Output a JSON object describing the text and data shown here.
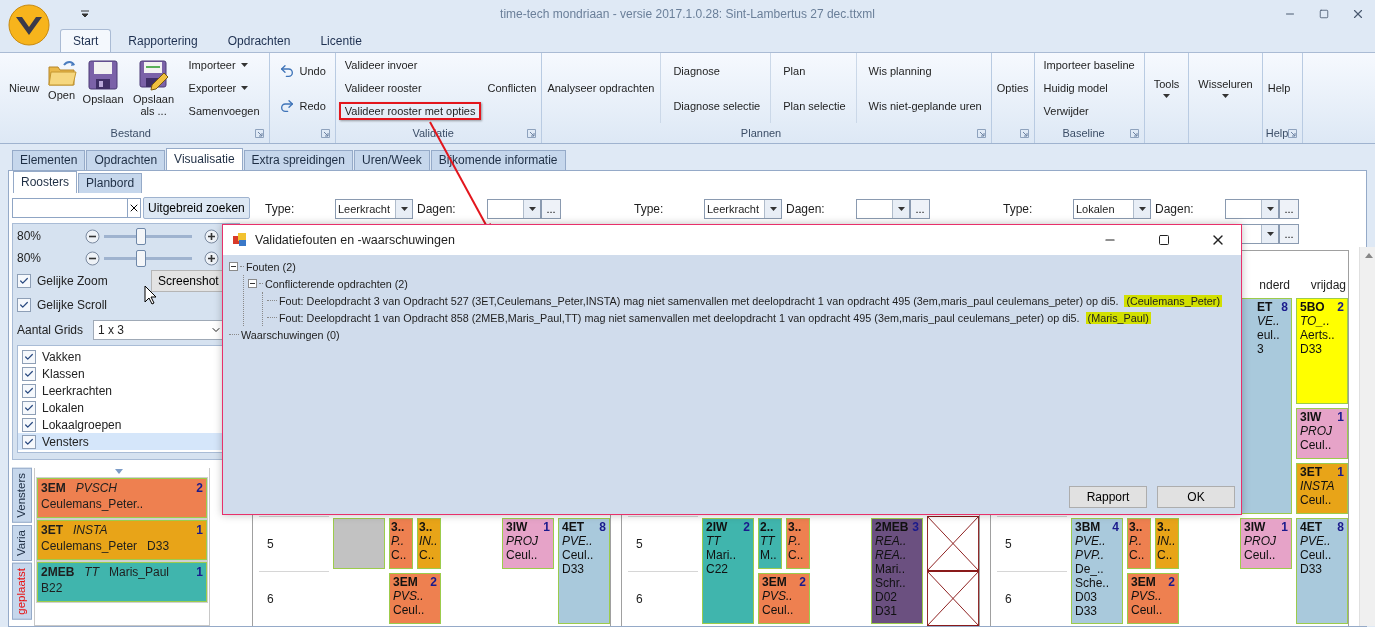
{
  "window": {
    "title": "time-tech mondriaan - versie 2017.1.0.28: Sint-Lambertus 27 dec.ttxml"
  },
  "ribbon_tabs": [
    {
      "label": "Start",
      "selected": true
    },
    {
      "label": "Rapportering",
      "selected": false
    },
    {
      "label": "Opdrachten",
      "selected": false
    },
    {
      "label": "Licentie",
      "selected": false
    }
  ],
  "ribbon_groups": [
    {
      "label": "Bestand",
      "launcher": true,
      "items": [
        {
          "kind": "text",
          "label": "Nieuw"
        },
        {
          "kind": "large",
          "label": "Open"
        },
        {
          "kind": "large",
          "label": "Opslaan"
        },
        {
          "kind": "large",
          "label": "Opslaan als ..."
        },
        {
          "kind": "stack",
          "divider": false,
          "entries": [
            {
              "label": "Importeer",
              "dropdown": true,
              "annotated": false
            },
            {
              "label": "Exporteer",
              "dropdown": true,
              "annotated": false
            },
            {
              "label": "Samenvoegen",
              "dropdown": false,
              "annotated": false
            }
          ]
        }
      ]
    },
    {
      "launcher": true,
      "items": [
        {
          "kind": "icon-stack",
          "entries": [
            {
              "label": "Undo"
            },
            {
              "label": "Redo"
            }
          ]
        }
      ]
    },
    {
      "label": "Validatie",
      "launcher": true,
      "items": [
        {
          "kind": "stack",
          "divider": false,
          "entries": [
            {
              "label": "Valideer invoer",
              "dropdown": false,
              "annotated": false
            },
            {
              "label": "Valideer rooster",
              "dropdown": false,
              "annotated": false
            },
            {
              "label": "Valideer rooster met opties",
              "dropdown": false,
              "annotated": true
            }
          ]
        },
        {
          "kind": "text",
          "label": "Conflicten"
        }
      ]
    },
    {
      "label": "Plannen",
      "launcher": true,
      "items": [
        {
          "kind": "text",
          "label": "Analyseer opdrachten"
        },
        {
          "kind": "stack",
          "divider": true,
          "entries": [
            {
              "label": "Diagnose",
              "dropdown": false,
              "annotated": false
            },
            {
              "label": "Diagnose selectie",
              "dropdown": false,
              "annotated": false
            }
          ]
        },
        {
          "kind": "stack",
          "divider": true,
          "entries": [
            {
              "label": "Plan",
              "dropdown": false,
              "annotated": false
            },
            {
              "label": "Plan selectie",
              "dropdown": false,
              "annotated": false
            }
          ]
        },
        {
          "kind": "stack",
          "divider": true,
          "entries": [
            {
              "label": "Wis planning",
              "dropdown": false,
              "annotated": false
            },
            {
              "label": "Wis niet-geplande uren",
              "dropdown": false,
              "annotated": false
            }
          ]
        }
      ]
    },
    {
      "launcher": true,
      "items": [
        {
          "kind": "text",
          "label": "Opties"
        }
      ]
    },
    {
      "label": "Baseline",
      "launcher": true,
      "items": [
        {
          "kind": "stack",
          "divider": false,
          "entries": [
            {
              "label": "Importeer baseline",
              "dropdown": false,
              "annotated": false
            },
            {
              "label": "Huidig model",
              "dropdown": false,
              "annotated": false
            },
            {
              "label": "Verwijder",
              "dropdown": false,
              "annotated": false
            }
          ]
        }
      ]
    },
    {
      "launcher": false,
      "items": [
        {
          "kind": "menu",
          "label": "Tools"
        }
      ]
    },
    {
      "launcher": false,
      "items": [
        {
          "kind": "menu",
          "label": "Wisseluren"
        }
      ]
    },
    {
      "label": "Help",
      "launcher": true,
      "items": [
        {
          "kind": "text",
          "label": "Help"
        }
      ]
    }
  ],
  "main_tabs": [
    {
      "label": "Elementen",
      "selected": false
    },
    {
      "label": "Opdrachten",
      "selected": false
    },
    {
      "label": "Visualisatie",
      "selected": true
    },
    {
      "label": "Extra spreidingen",
      "selected": false
    },
    {
      "label": "Uren/Week",
      "selected": false
    },
    {
      "label": "Bijkomende informatie",
      "selected": false
    }
  ],
  "sub_tabs": [
    {
      "label": "Roosters",
      "selected": true
    },
    {
      "label": "Planbord",
      "selected": false
    }
  ],
  "left_panel": {
    "search_button": "Uitgebreid zoeken",
    "zoom_rows": [
      {
        "reading": "80%",
        "level": 0.42
      },
      {
        "reading": "80%",
        "level": 0.42
      }
    ],
    "options": [
      {
        "label": "Gelijke Zoom",
        "checked": true
      },
      {
        "label": "Gelijke Scroll",
        "checked": true
      }
    ],
    "screenshot_button": "Screenshot",
    "grids": {
      "label": "Aantal Grids",
      "value": "1 x 3"
    },
    "layers": [
      {
        "label": "Vakken",
        "checked": true,
        "selected": false
      },
      {
        "label": "Klassen",
        "checked": true,
        "selected": false
      },
      {
        "label": "Leerkrachten",
        "checked": true,
        "selected": false
      },
      {
        "label": "Lokalen",
        "checked": true,
        "selected": false
      },
      {
        "label": "Lokaalgroepen",
        "checked": true,
        "selected": false
      },
      {
        "label": "Vensters",
        "checked": true,
        "selected": true
      }
    ],
    "side_tabs": [
      {
        "label": "Vensters",
        "alert": false
      },
      {
        "label": "Varia",
        "alert": false
      },
      {
        "label": "geplaatst",
        "alert": true
      }
    ],
    "pending_cards": [
      {
        "code": "3EM",
        "subject": "PVSCH",
        "count": "2",
        "lines": [
          "Ceulemans_Peter.."
        ],
        "color": "#ee8050"
      },
      {
        "code": "3ET",
        "subject": "INSTA",
        "count": "1",
        "lines": [
          "Ceulemans_Peter",
          "D33"
        ],
        "color": "#e8a418"
      },
      {
        "code": "2MEB",
        "subject": "TT",
        "extra": "Maris_Paul",
        "count": "1",
        "lines": [
          "B22"
        ],
        "color": "#40b5ad"
      }
    ]
  },
  "panels": [
    {
      "type_label": "Type:",
      "type_value": "Leerkracht",
      "days_label": "Dagen:",
      "more": "...",
      "rows": [
        {
          "label": "5",
          "cells": [
            {
              "kind": "blocked"
            },
            {
              "kind": "card",
              "code": "3..",
              "subjects": [
                "P.."
              ],
              "lines": [
                "C.."
              ],
              "color": "#ee8050"
            },
            {
              "kind": "card",
              "code": "3..",
              "subjects": [
                "IN.."
              ],
              "lines": [
                "C.."
              ],
              "color": "#e8a418"
            },
            {
              "kind": "blank"
            },
            {
              "kind": "card",
              "code": "3IW",
              "count": "1",
              "subjects": [
                "PROJ"
              ],
              "lines": [
                "Ceul.."
              ],
              "color": "#e6a3c8"
            },
            {
              "kind": "card",
              "code": "4ET",
              "count": "8",
              "subjects": [
                "PVE.."
              ],
              "lines": [
                "Ceul..",
                "D33"
              ],
              "color": "#a9c9dc",
              "tall": true
            }
          ]
        },
        {
          "label": "6",
          "cells": [
            {
              "kind": "blank"
            },
            {
              "kind": "wide",
              "code": "3EM",
              "count": "2",
              "subjects": [
                "PVS.."
              ],
              "lines": [
                "Ceul.."
              ],
              "color": "#ee8050"
            },
            {
              "kind": "blank"
            },
            {
              "kind": "blank"
            },
            {
              "kind": "spanned"
            }
          ]
        }
      ]
    },
    {
      "type_label": "Type:",
      "type_value": "Leerkracht",
      "days_label": "Dagen:",
      "more": "...",
      "rows": [
        {
          "label": "5",
          "cells": [
            {
              "kind": "card",
              "code": "2IW",
              "count": "2",
              "subjects": [
                "TT"
              ],
              "lines": [
                "Mari..",
                "C22"
              ],
              "color": "#40b5ad",
              "tall": true
            },
            {
              "kind": "card",
              "code": "2..",
              "subjects": [
                "TT"
              ],
              "lines": [
                "M.."
              ],
              "color": "#40b5ad"
            },
            {
              "kind": "card",
              "code": "3..",
              "subjects": [
                "P.."
              ],
              "lines": [
                "C.."
              ],
              "color": "#ee8050"
            },
            {
              "kind": "blank"
            },
            {
              "kind": "card",
              "code": "2MEB",
              "count": "3",
              "subjects": [
                "REA..",
                "REA.."
              ],
              "lines": [
                "Mari..",
                "Schr..",
                "D02",
                "D31"
              ],
              "color": "#6b5080",
              "tall": true
            },
            {
              "kind": "crossed"
            }
          ]
        },
        {
          "label": "6",
          "cells": [
            {
              "kind": "spanned"
            },
            {
              "kind": "wide",
              "code": "3EM",
              "count": "2",
              "subjects": [
                "PVS.."
              ],
              "lines": [
                "Ceul.."
              ],
              "color": "#ee8050"
            },
            {
              "kind": "blank"
            },
            {
              "kind": "spanned"
            },
            {
              "kind": "crossed"
            }
          ]
        }
      ]
    },
    {
      "type_label": "Type:",
      "type_value": "Lokalen",
      "days_label": "Dagen:",
      "more": "...",
      "second_more": "...",
      "upper_columns": [
        {
          "header": "nderd",
          "cards": [
            {
              "kind": "clipped",
              "code": "ET",
              "count": "8",
              "subjects": [
                "VE.."
              ],
              "lines": [
                "eul..",
                "3"
              ],
              "color": "#a9c9dc"
            }
          ]
        },
        {
          "header": "vrijdag",
          "cards": [
            {
              "kind": "card",
              "code": "5BO",
              "count": "2",
              "subjects": [
                "TO_.."
              ],
              "lines": [
                "Aerts..",
                "D33"
              ],
              "color": "#ffff00",
              "tall": true
            },
            {
              "kind": "card",
              "code": "3IW",
              "count": "1",
              "subjects": [
                "PROJ"
              ],
              "lines": [
                "Ceul.."
              ],
              "color": "#e6a3c8"
            },
            {
              "kind": "card",
              "code": "3ET",
              "count": "1",
              "subjects": [
                "INSTA"
              ],
              "lines": [
                "Ceul.."
              ],
              "color": "#e8a418"
            }
          ]
        }
      ],
      "rows": [
        {
          "label": "5",
          "cells": [
            {
              "kind": "card",
              "code": "3BM",
              "count": "4",
              "subjects": [
                "PVE..",
                "PVP.."
              ],
              "lines": [
                "De_..",
                "Sche..",
                "D03",
                "D33"
              ],
              "color": "#a9c9dc",
              "tall": true
            },
            {
              "kind": "card",
              "code": "3..",
              "subjects": [
                "P.."
              ],
              "lines": [
                "C.."
              ],
              "color": "#ee8050"
            },
            {
              "kind": "card",
              "code": "3..",
              "subjects": [
                "IN.."
              ],
              "lines": [
                "C.."
              ],
              "color": "#e8a418"
            },
            {
              "kind": "blank"
            },
            {
              "kind": "card",
              "code": "3IW",
              "count": "1",
              "subjects": [
                "PROJ"
              ],
              "lines": [
                "Ceul.."
              ],
              "color": "#e6a3c8"
            },
            {
              "kind": "card",
              "code": "4ET",
              "count": "8",
              "subjects": [
                "PVE.."
              ],
              "lines": [
                "Ceul..",
                "D33"
              ],
              "color": "#a9c9dc",
              "tall": true
            }
          ]
        },
        {
          "label": "6",
          "cells": [
            {
              "kind": "spanned"
            },
            {
              "kind": "wide",
              "code": "3EM",
              "count": "2",
              "subjects": [
                "PVS.."
              ],
              "lines": [
                "Ceul.."
              ],
              "color": "#ee8050"
            },
            {
              "kind": "blank"
            },
            {
              "kind": "blank"
            },
            {
              "kind": "spanned"
            }
          ]
        }
      ]
    }
  ],
  "dialog": {
    "title": "Validatiefouten en -waarschuwingen",
    "tree": [
      {
        "label": "Fouten (2)",
        "expanded": true,
        "children": [
          {
            "label": "Conflicterende opdrachten (2)",
            "expanded": true,
            "children": [
              {
                "label": "Fout: Deelopdracht 3 van Opdracht 527 (3ET,Ceulemans_Peter,INSTA) mag niet samenvallen met deelopdracht 1 van opdracht 495 (3em,maris_paul ceulemans_peter) op di5.",
                "highlight": "(Ceulemans_Peter)"
              },
              {
                "label": "Fout: Deelopdracht 1 van Opdracht 858 (2MEB,Maris_Paul,TT) mag niet samenvallen met deelopdracht 1 van opdracht 495 (3em,maris_paul ceulemans_peter) op di5.",
                "highlight": "(Maris_Paul)"
              }
            ]
          }
        ]
      },
      {
        "label": "Waarschuwingen (0)"
      }
    ],
    "buttons": [
      "Rapport",
      "OK"
    ]
  }
}
